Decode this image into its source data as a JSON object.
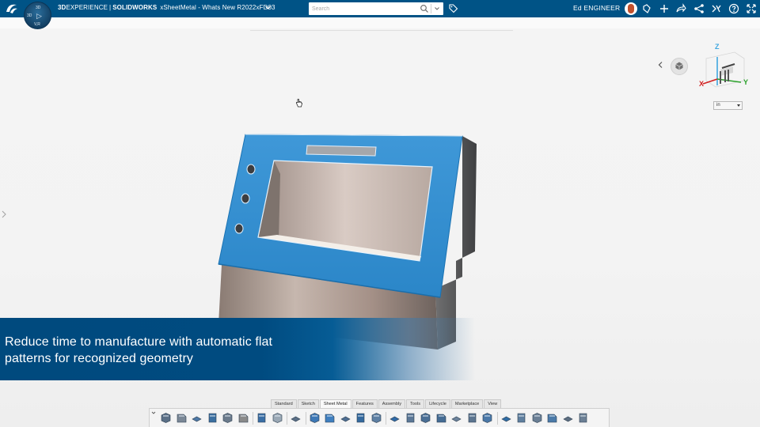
{
  "header": {
    "brand_3d": "3D",
    "brand_experience": "EXPERIENCE",
    "brand_separator": "|",
    "brand_app": "SOLIDWORKS",
    "document_title": "xSheetMetal - Whats New R2022xFD03",
    "search_placeholder": "Search",
    "user_name": "Ed ENGINEER",
    "accent_color": "#005386"
  },
  "compass": {
    "top": "3D",
    "left": "3D",
    "play": "▷",
    "bottom": "V,R"
  },
  "viewport": {
    "units_value": "in"
  },
  "banner": {
    "text_line1": "Reduce time to manufacture with automatic flat",
    "text_line2": "patterns for recognized geometry"
  },
  "command_tabs": [
    {
      "label": "Standard",
      "active": false
    },
    {
      "label": "Sketch",
      "active": false
    },
    {
      "label": "Sheet Metal",
      "active": true
    },
    {
      "label": "Features",
      "active": false
    },
    {
      "label": "Assembly",
      "active": false
    },
    {
      "label": "Tools",
      "active": false
    },
    {
      "label": "Lifecycle",
      "active": false
    },
    {
      "label": "Marketplace",
      "active": false
    },
    {
      "label": "View",
      "active": false
    }
  ],
  "triad": {
    "x": "X",
    "y": "Y",
    "z": "Z"
  },
  "icons": {
    "ds_logo": "ds-logo-icon",
    "search": "search-icon",
    "tag": "tag-icon",
    "notifications": "notification-icon",
    "add": "add-icon",
    "share": "share-icon",
    "network": "network-icon",
    "tools": "tools-icon",
    "help": "help-icon",
    "fullscreen": "fullscreen-icon"
  }
}
